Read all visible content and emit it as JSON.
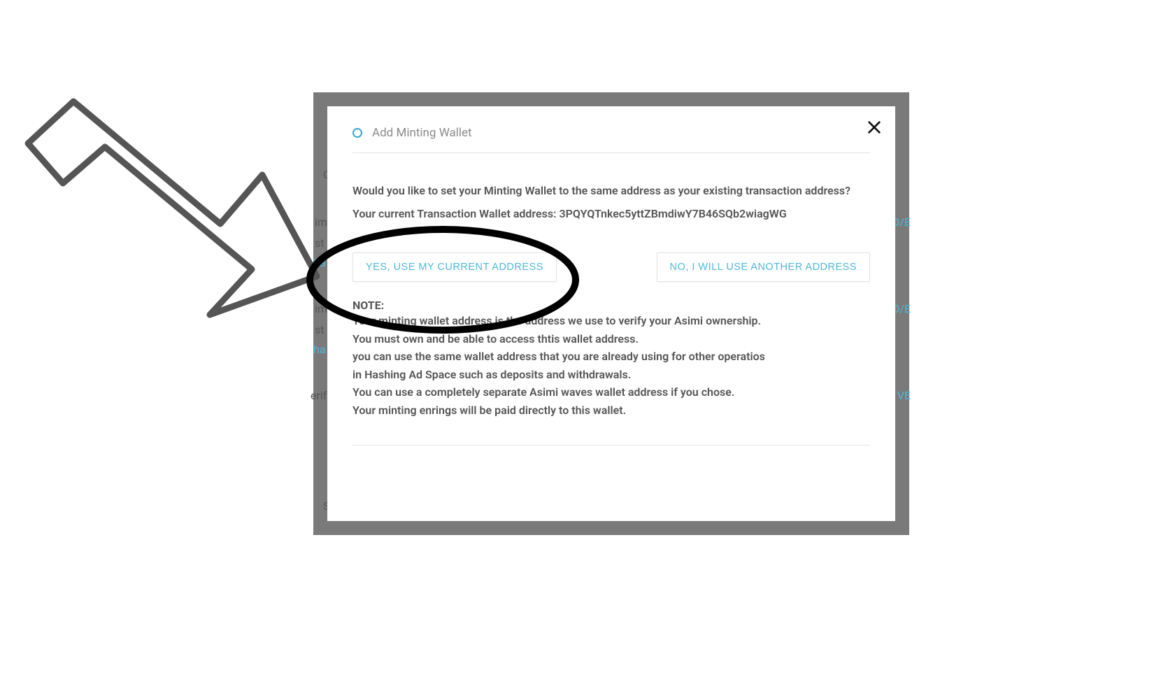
{
  "modal": {
    "title": "Add Minting Wallet",
    "question": "Would you like to set your Minting Wallet to the same address as your existing transaction address?",
    "current_address_label": "Your current Transaction Wallet address:",
    "current_address_value": "3PQYQTnkec5yttZBmdiwY7B46SQb2wiagWG",
    "yes_button": "YES, USE MY CURRENT ADDRESS",
    "no_button": "NO, I WILL USE ANOTHER ADDRESS",
    "note_heading": "NOTE:",
    "note_lines": [
      "Your minting wallet address is the address we use to verify your Asimi ownership.",
      "You must own and be able to access thtis wallet address.",
      "you can use the same wallet address that you are already using for other operatios",
      "in Hashing Ad Space such as deposits and withdrawals.",
      "You can use a completely separate Asimi waves wallet address if you chose.",
      "Your minting enrings will be paid directly to this wallet."
    ]
  },
  "background_fragments": {
    "C": "C",
    "frag1a": "im",
    "frag1b": "st",
    "frag1c": "ha",
    "frag1d": "D/E",
    "frag2a": "im",
    "frag2b": "st",
    "frag2c": "ha",
    "frag2d": "D/E",
    "frag3a": "erif",
    "frag3b": "VE",
    "frag4": "S"
  }
}
